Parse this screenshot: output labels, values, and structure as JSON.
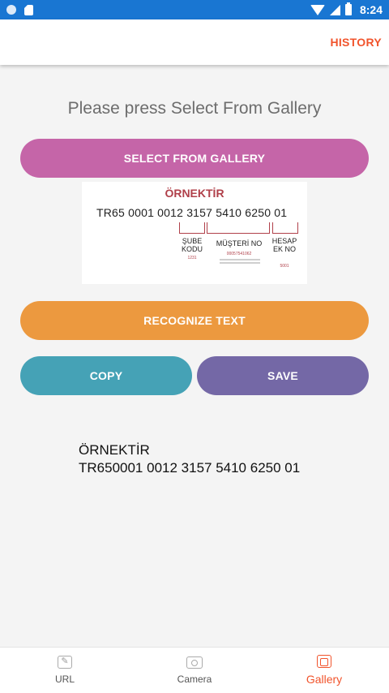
{
  "status_bar": {
    "time": "8:24",
    "icons": [
      "circle-icon",
      "sd-card-icon",
      "wifi-icon",
      "signal-icon",
      "battery-icon"
    ]
  },
  "app_bar": {
    "history_label": "HISTORY",
    "accent": "#f1542c"
  },
  "main": {
    "prompt": "Please press Select From Gallery",
    "select_gallery_label": "SELECT FROM GALLERY",
    "recognize_label": "RECOGNIZE TEXT",
    "copy_label": "COPY",
    "save_label": "SAVE",
    "sample_image": {
      "title": "ÖRNEKTİR",
      "iban": "TR65 0001 0012 3157 5410 6250 01",
      "label_sube": "ŞUBE KODU",
      "label_musteri": "MÜŞTERİ NO",
      "label_hesap": "HESAP EK NO",
      "sub_sube": "1231",
      "sub_musteri": "00057541062",
      "sub_hesap": "5001"
    },
    "result_line1": "ÖRNEKTİR",
    "result_line2": "TR650001 0012 3157 5410 6250 01"
  },
  "colors": {
    "gallery_button": "#c565a8",
    "recognize_button": "#ec993f",
    "copy_button": "#45a2b6",
    "save_button": "#7468a6"
  },
  "bottom_nav": {
    "items": [
      {
        "label": "URL",
        "icon": "edit-icon"
      },
      {
        "label": "Camera",
        "icon": "camera-icon"
      },
      {
        "label": "Gallery",
        "icon": "gallery-icon",
        "active": true
      }
    ]
  }
}
